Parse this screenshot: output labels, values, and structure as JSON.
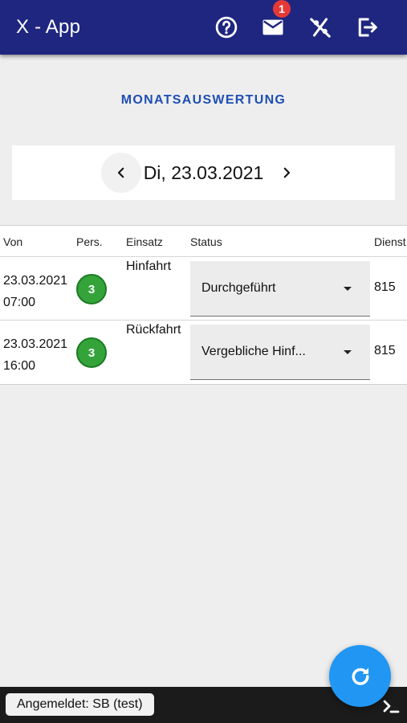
{
  "app": {
    "title": "X - App",
    "notification_count": "1"
  },
  "icons": {
    "help": "help-circle-icon",
    "mail": "mail-icon",
    "percent": "percent-off-icon",
    "logout": "logout-icon",
    "refresh": "refresh-icon",
    "terminal": "terminal-icon"
  },
  "page": {
    "title": "MONATSAUSWERTUNG"
  },
  "date_nav": {
    "current_date": "Di, 23.03.2021"
  },
  "table": {
    "headers": {
      "von": "Von",
      "pers": "Pers.",
      "einsatz": "Einsatz",
      "status": "Status",
      "dienst": "Dienst"
    },
    "rows": [
      {
        "von_date": "23.03.2021",
        "von_time": "07:00",
        "pers": "3",
        "einsatz": "Hinfahrt",
        "status": "Durchgeführt",
        "dienst": "815"
      },
      {
        "von_date": "23.03.2021",
        "von_time": "16:00",
        "pers": "3",
        "einsatz": "Rückfahrt",
        "status": "Vergebliche Hinf...",
        "dienst": "815"
      }
    ]
  },
  "footer": {
    "login_status": "Angemeldet: SB (test)"
  },
  "colors": {
    "appbar": "#1f2680",
    "accent": "#1f4fb3",
    "badge_green": "#34a43a",
    "fab": "#2196f3",
    "notification_badge": "#e53935",
    "footer": "#1b1b1b"
  }
}
